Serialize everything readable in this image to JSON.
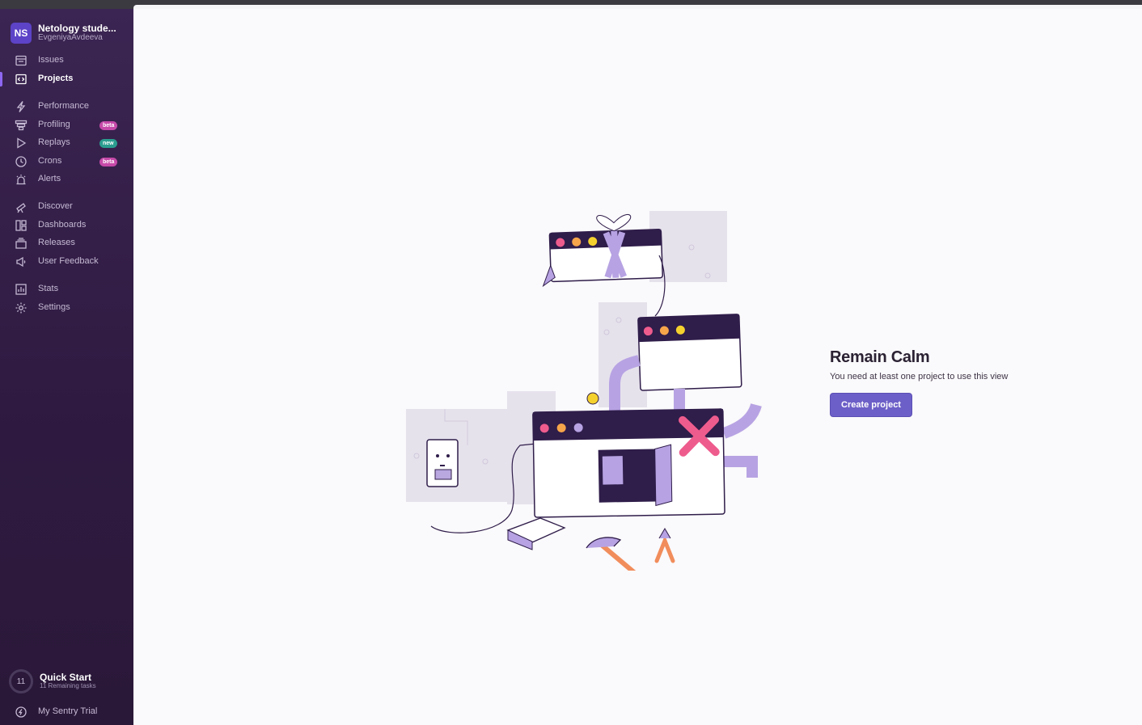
{
  "org": {
    "initials": "NS",
    "name": "Netology stude...",
    "user": "EvgeniyaAvdeeva"
  },
  "nav": {
    "issues": "Issues",
    "projects": "Projects",
    "performance": "Performance",
    "profiling": "Profiling",
    "profiling_badge": "beta",
    "replays": "Replays",
    "replays_badge": "new",
    "crons": "Crons",
    "crons_badge": "beta",
    "alerts": "Alerts",
    "discover": "Discover",
    "dashboards": "Dashboards",
    "releases": "Releases",
    "user_feedback": "User Feedback",
    "stats": "Stats",
    "settings": "Settings"
  },
  "quick_start": {
    "count": "11",
    "title": "Quick Start",
    "subtitle": "11 Remaining tasks"
  },
  "trial": "My Sentry Trial",
  "empty_state": {
    "title": "Remain Calm",
    "message": "You need at least one project to use this view",
    "button": "Create project"
  },
  "colors": {
    "accent": "#6c5fc7",
    "sidebar": "#2e1a40",
    "beta": "#c64aa9",
    "new": "#2a9d8f"
  }
}
